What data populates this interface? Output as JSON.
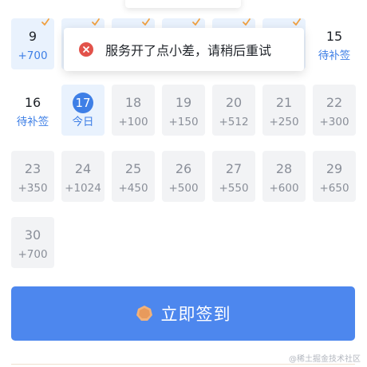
{
  "toast": {
    "message": "服务开了点小差，请稍后重试",
    "icon": "error-icon"
  },
  "calendar": {
    "cells": [
      {
        "day": "9",
        "sub": "+700",
        "state": "signed",
        "checked": true
      },
      {
        "day": "",
        "sub": "",
        "state": "signed",
        "checked": true
      },
      {
        "day": "",
        "sub": "",
        "state": "signed",
        "checked": true
      },
      {
        "day": "",
        "sub": "",
        "state": "signed",
        "checked": true
      },
      {
        "day": "",
        "sub": "",
        "state": "signed",
        "checked": true
      },
      {
        "day": "",
        "sub": "",
        "state": "signed",
        "checked": true
      },
      {
        "day": "15",
        "sub": "待补签",
        "state": "pending",
        "checked": false
      },
      {
        "day": "16",
        "sub": "待补签",
        "state": "pending",
        "checked": false
      },
      {
        "day": "17",
        "sub": "今日",
        "state": "today",
        "checked": false
      },
      {
        "day": "18",
        "sub": "+100",
        "state": "future",
        "checked": false
      },
      {
        "day": "19",
        "sub": "+150",
        "state": "future",
        "checked": false
      },
      {
        "day": "20",
        "sub": "+512",
        "state": "future",
        "checked": false
      },
      {
        "day": "21",
        "sub": "+250",
        "state": "future",
        "checked": false
      },
      {
        "day": "22",
        "sub": "+300",
        "state": "future",
        "checked": false
      },
      {
        "day": "23",
        "sub": "+350",
        "state": "future",
        "checked": false
      },
      {
        "day": "24",
        "sub": "+1024",
        "state": "future",
        "checked": false
      },
      {
        "day": "25",
        "sub": "+450",
        "state": "future",
        "checked": false
      },
      {
        "day": "26",
        "sub": "+500",
        "state": "future",
        "checked": false
      },
      {
        "day": "27",
        "sub": "+550",
        "state": "future",
        "checked": false
      },
      {
        "day": "28",
        "sub": "+600",
        "state": "future",
        "checked": false
      },
      {
        "day": "29",
        "sub": "+650",
        "state": "future",
        "checked": false
      },
      {
        "day": "30",
        "sub": "+700",
        "state": "future",
        "checked": false
      }
    ]
  },
  "signin_button": {
    "label": "立即签到",
    "icon": "coin-icon"
  },
  "watermark": "@稀土掘金技术社区",
  "colors": {
    "accent": "#4d87ee",
    "signed_bg": "#e9f2fd",
    "future_bg": "#f2f3f5",
    "check": "#f0a040",
    "error": "#e2524a"
  }
}
